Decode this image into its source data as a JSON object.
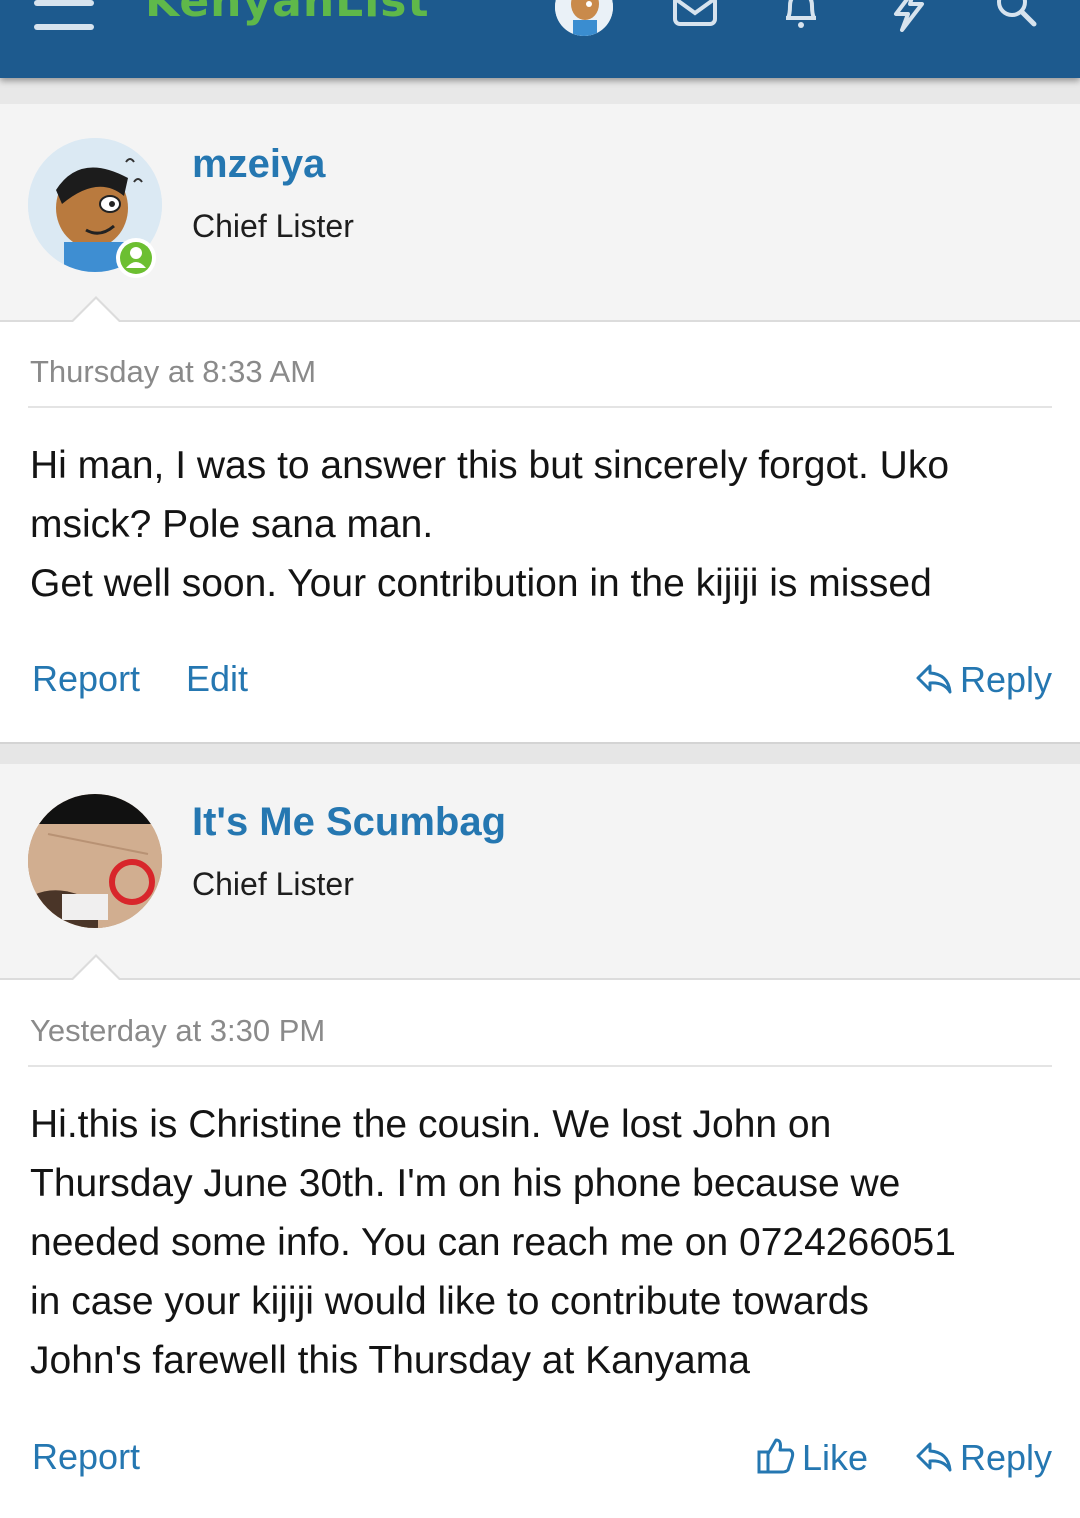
{
  "header": {
    "logo_text": "KenyanList",
    "icons": [
      "menu-icon",
      "avatar",
      "envelope-icon",
      "bell-icon",
      "bolt-icon",
      "search-icon"
    ]
  },
  "posts": [
    {
      "username": "mzeiya",
      "user_title": "Chief Lister",
      "online": true,
      "timestamp": "Thursday at 8:33 AM",
      "body_lines": [
        "Hi man, I was to answer this but sincerely forgot. Uko",
        "msick? Pole sana man.",
        "Get well soon. Your contribution in the kijiji is missed"
      ],
      "actions": {
        "report": "Report",
        "edit": "Edit",
        "reply": "Reply"
      }
    },
    {
      "username": "It's Me Scumbag",
      "user_title": "Chief Lister",
      "online": false,
      "timestamp": "Yesterday at 3:30 PM",
      "body_lines": [
        "Hi.this is Christine the cousin. We lost John on",
        "Thursday June 30th. I'm on his phone because we",
        "needed some info. You can reach me on 0724266051",
        "in case your kijiji would like to contribute towards",
        "John's farewell this Thursday at Kanyama"
      ],
      "actions": {
        "report": "Report",
        "like": "Like",
        "reply": "Reply"
      }
    }
  ],
  "colors": {
    "header_bg": "#1d5a8e",
    "link": "#2577b1",
    "online": "#6cbf31"
  }
}
